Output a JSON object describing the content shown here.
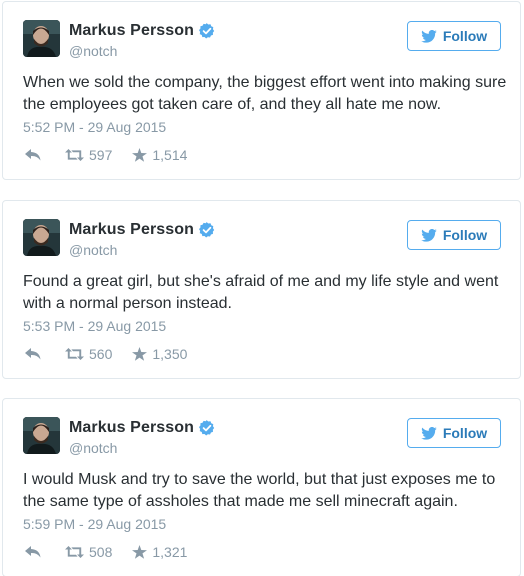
{
  "colors": {
    "text": "#292f33",
    "muted": "#8899a6",
    "accent": "#55acee",
    "follow_text": "#2b7bb9",
    "border": "#e1e8ed"
  },
  "icons": {
    "verified": "verified-badge-icon",
    "twitter_bird": "twitter-bird-icon",
    "reply": "reply-arrow-icon",
    "retweet": "retweet-icon",
    "favorite": "star-icon"
  },
  "tweets": [
    {
      "author_name": "Markus Persson",
      "author_handle": "@notch",
      "follow_label": "Follow",
      "text": "When we sold the company, the biggest effort went into making sure the employees got taken care of, and they all hate me now.",
      "timestamp": "5:52 PM - 29 Aug 2015",
      "retweets": "597",
      "favorites": "1,514"
    },
    {
      "author_name": "Markus Persson",
      "author_handle": "@notch",
      "follow_label": "Follow",
      "text": "Found a great girl, but she's afraid of me and my life style and went with a normal person instead.",
      "timestamp": "5:53 PM - 29 Aug 2015",
      "retweets": "560",
      "favorites": "1,350"
    },
    {
      "author_name": "Markus Persson",
      "author_handle": "@notch",
      "follow_label": "Follow",
      "text": "I would Musk and try to save the world, but that just exposes me to the same type of assholes that made me sell minecraft again.",
      "timestamp": "5:59 PM - 29 Aug 2015",
      "retweets": "508",
      "favorites": "1,321"
    }
  ]
}
